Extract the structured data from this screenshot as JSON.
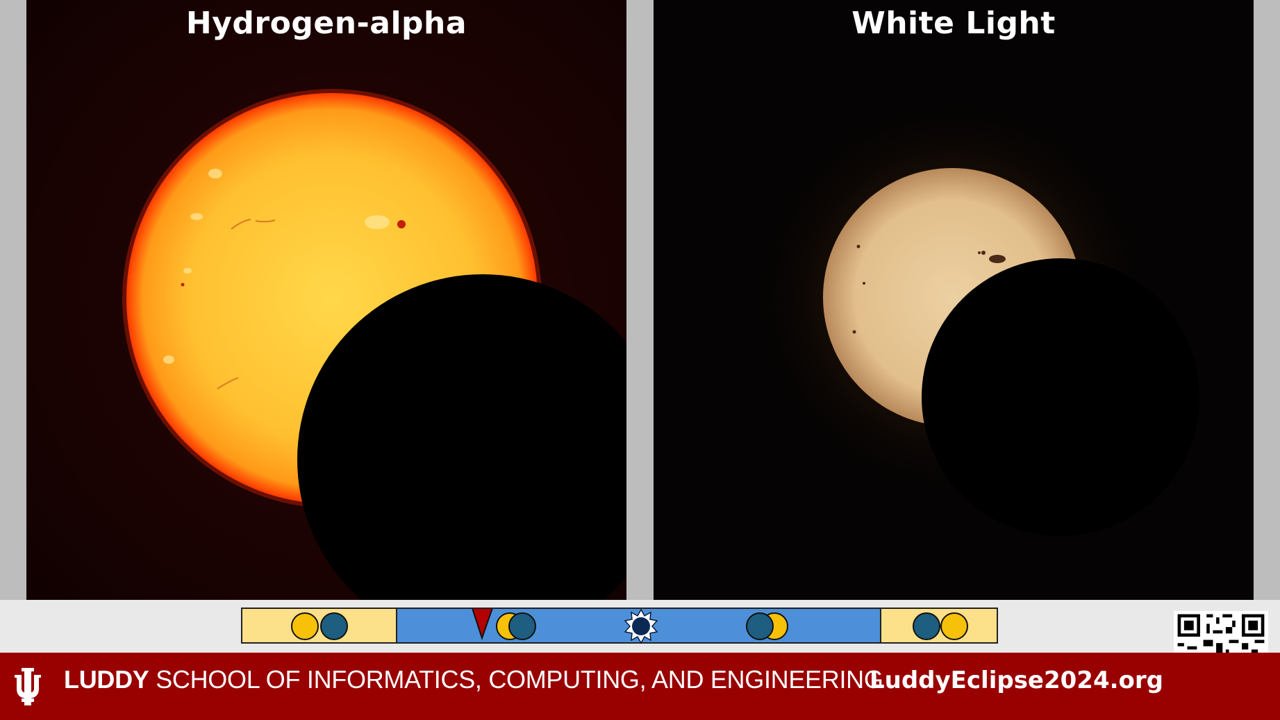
{
  "panels": {
    "left_title": "Hydrogen-alpha",
    "right_title": "White Light"
  },
  "timeline": {
    "phases": [
      "partial-before",
      "in-progress",
      "totality",
      "in-progress",
      "partial-after"
    ],
    "current_marker_color": "#b30000",
    "colors": {
      "partial": "#fde08a",
      "active": "#4d90d9",
      "sun": "#f7c10a",
      "moon": "#1e5e80"
    }
  },
  "footer": {
    "school_bold": "LUDDY",
    "school_rest": " SCHOOL OF INFORMATICS, COMPUTING, AND ENGINEERING",
    "url": "LuddyEclipse2024.org",
    "bg_color": "#990000"
  }
}
